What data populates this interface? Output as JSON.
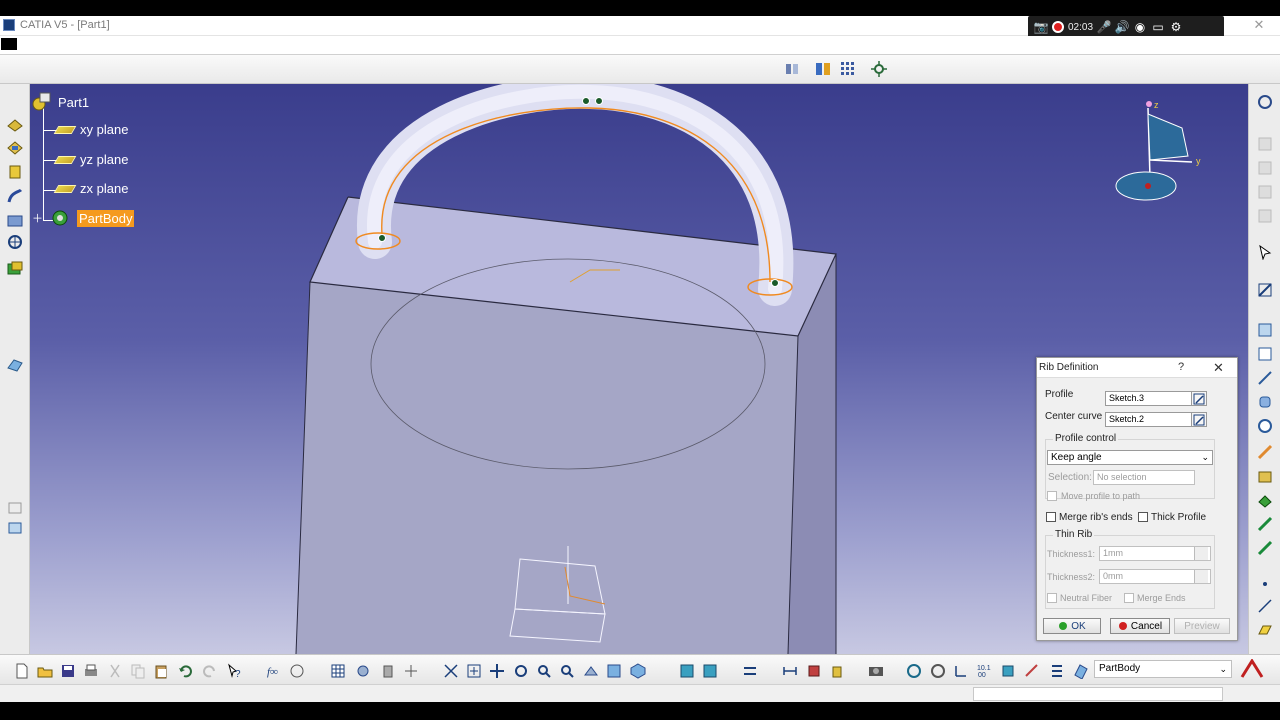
{
  "window": {
    "title": "CATIA V5 - [Part1]"
  },
  "recorder": {
    "elapsed": "02:03"
  },
  "tree": {
    "root": "Part1",
    "items": [
      {
        "label": "xy plane"
      },
      {
        "label": "yz plane"
      },
      {
        "label": "zx plane"
      }
    ],
    "body": "PartBody"
  },
  "compass": {
    "axis_z": "z",
    "axis_y": "y"
  },
  "dialog": {
    "title": "Rib Definition",
    "help": "?",
    "profile_label": "Profile",
    "profile_value": "Sketch.3",
    "center_curve_label": "Center curve",
    "center_curve_value": "Sketch.2",
    "profile_control_label": "Profile control",
    "profile_control_value": "Keep angle",
    "selection_label": "Selection:",
    "selection_value": "No selection",
    "move_profile_label": "Move profile to path",
    "merge_ribs_label": "Merge rib's ends",
    "thick_profile_label": "Thick Profile",
    "thin_rib_label": "Thin Rib",
    "thickness1_label": "Thickness1:",
    "thickness1_value": "1mm",
    "thickness2_label": "Thickness2:",
    "thickness2_value": "0mm",
    "neutral_fiber_label": "Neutral Fiber",
    "merge_ends_label": "Merge Ends",
    "ok_label": "OK",
    "cancel_label": "Cancel",
    "preview_label": "Preview"
  },
  "bottom": {
    "current_body": "PartBody"
  },
  "colors": {
    "selection": "#f59a1e",
    "viewport_top": "#3a3d8c",
    "viewport_bottom": "#c7c8e2"
  }
}
